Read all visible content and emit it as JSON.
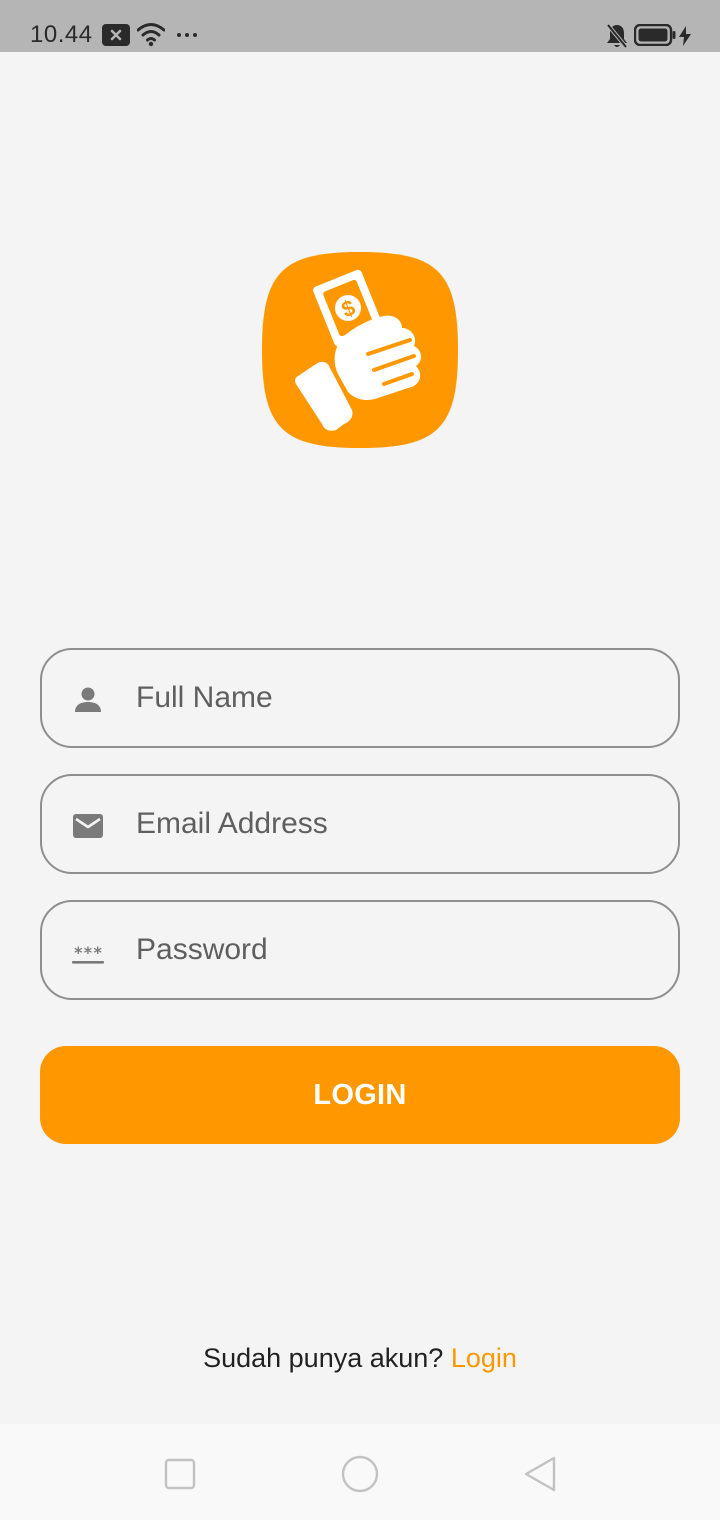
{
  "status_bar": {
    "time": "10.44",
    "icons": [
      "notification-x-icon",
      "wifi-icon",
      "more-dots-icon",
      "bell-off-icon",
      "battery-icon",
      "charging-icon"
    ]
  },
  "logo": {
    "icon": "hand-money-icon"
  },
  "form": {
    "full_name": {
      "icon": "person-icon",
      "placeholder": "Full Name",
      "value": ""
    },
    "email": {
      "icon": "mail-icon",
      "placeholder": "Email Address",
      "value": ""
    },
    "password": {
      "icon": "password-icon",
      "placeholder": "Password",
      "value": ""
    }
  },
  "login_button": {
    "label": "LOGIN"
  },
  "footer": {
    "prompt": "Sudah punya akun?",
    "link": "Login"
  },
  "nav_bar": {
    "icons": [
      "recents-square-icon",
      "home-circle-icon",
      "back-triangle-icon"
    ]
  },
  "colors": {
    "accent": "#ff9800",
    "background": "#f4f4f4",
    "status_bar": "#b5b5b5",
    "field_border": "#8e8e8e",
    "icon_gray": "#7a7a7a"
  }
}
